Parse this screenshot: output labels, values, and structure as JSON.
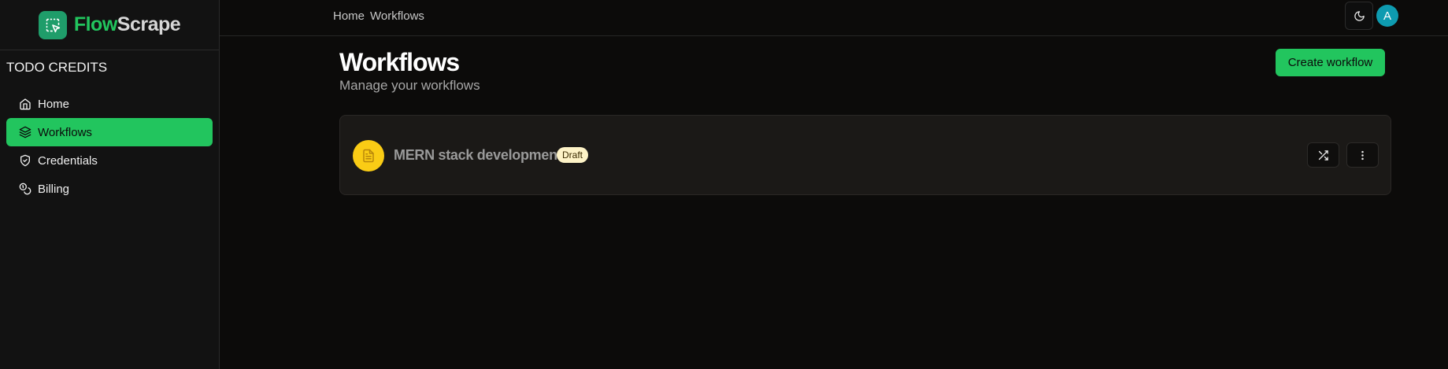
{
  "brand": {
    "flow": "Flow",
    "scrape": "Scrape",
    "logo_icon": "mouse-pointer-square-dashed-icon",
    "accent": "#22c55e"
  },
  "sidebar": {
    "credits_label": "TODO CREDITS",
    "items": [
      {
        "label": "Home",
        "icon": "home-icon",
        "active": false
      },
      {
        "label": "Workflows",
        "icon": "layers-icon",
        "active": true
      },
      {
        "label": "Credentials",
        "icon": "shield-check-icon",
        "active": false
      },
      {
        "label": "Billing",
        "icon": "coins-icon",
        "active": false
      }
    ]
  },
  "topbar": {
    "breadcrumb": [
      "Home",
      "Workflows"
    ],
    "theme_icon": "moon-icon",
    "avatar_initial": "A",
    "avatar_color": "#0e9bb0"
  },
  "page": {
    "title": "Workflows",
    "subtitle": "Manage your workflows",
    "create_label": "Create workflow"
  },
  "workflows": [
    {
      "name": "MERN stack development",
      "status": "Draft",
      "icon": "file-text-icon",
      "status_color": "#facc15",
      "actions": [
        "shuffle-icon",
        "more-vertical-icon"
      ]
    }
  ]
}
